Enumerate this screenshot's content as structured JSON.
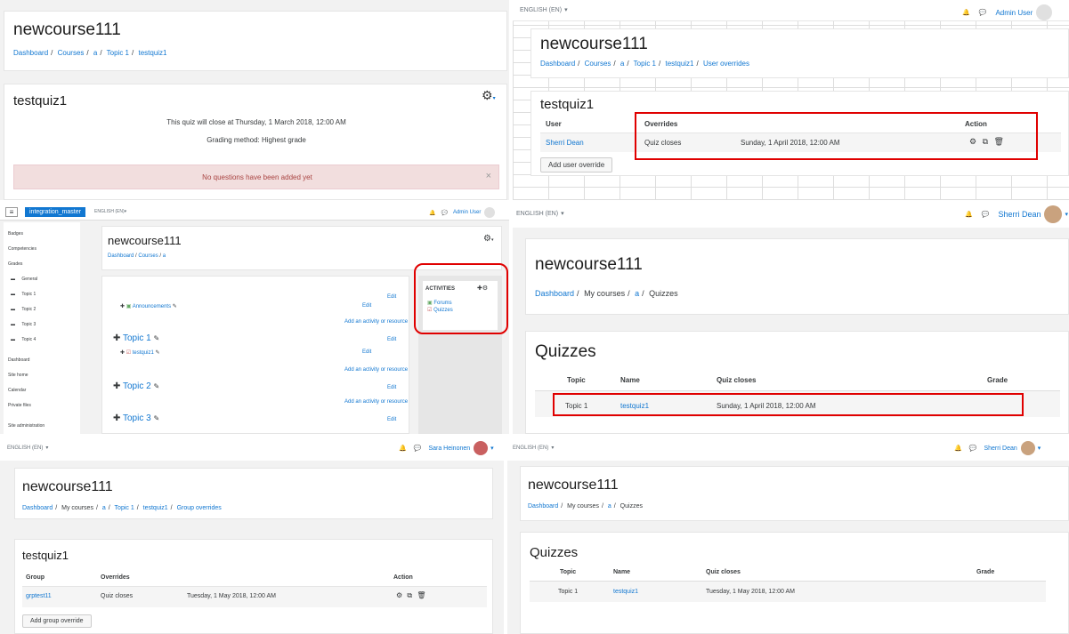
{
  "p1": {
    "title": "newcourse111",
    "breadcrumb": [
      "Dashboard",
      "Courses",
      "a",
      "Topic 1",
      "testquiz1"
    ],
    "quiz_title": "testquiz1",
    "close_text": "This quiz will close at Thursday, 1 March 2018, 12:00 AM",
    "grading": "Grading method: Highest grade",
    "alert": "No questions have been added yet",
    "alert_close": "×"
  },
  "p2": {
    "lang": "ENGLISH (EN)",
    "user": "Admin User",
    "title": "newcourse111",
    "breadcrumb": [
      "Dashboard",
      "Courses",
      "a",
      "Topic 1",
      "testquiz1",
      "User overrides"
    ],
    "quiz_title": "testquiz1",
    "col_user": "User",
    "col_overrides": "Overrides",
    "col_action": "Action",
    "row_user": "Sherri Dean",
    "row_override": "Quiz closes",
    "row_date": "Sunday, 1 April 2018, 12:00 AM",
    "add_button": "Add user override"
  },
  "p3": {
    "site": "integration_master",
    "lang": "ENGLISH (EN)",
    "user": "Admin User",
    "sidebar": [
      "Badges",
      "Competencies",
      "Grades"
    ],
    "sections": [
      "General",
      "Topic 1",
      "Topic 2",
      "Topic 3",
      "Topic 4"
    ],
    "sidebar2": [
      "Dashboard",
      "Site home",
      "Calendar",
      "Private files"
    ],
    "site_admin": "Site administration",
    "title": "newcourse111",
    "breadcrumb": [
      "Dashboard",
      "Courses",
      "a"
    ],
    "announcements": "Announcements",
    "edit": "Edit",
    "add_activity": "Add an activity or resource",
    "topic1": "Topic 1",
    "testquiz": "testquiz1",
    "topic2": "Topic 2",
    "topic3": "Topic 3",
    "activities_title": "ACTIVITIES",
    "forums": "Forums",
    "quizzes": "Quizzes"
  },
  "p4": {
    "lang": "ENGLISH (EN)",
    "user": "Sherri Dean",
    "title": "newcourse111",
    "breadcrumb": [
      "Dashboard",
      "My courses",
      "a",
      "Quizzes"
    ],
    "section_title": "Quizzes",
    "col_topic": "Topic",
    "col_name": "Name",
    "col_closes": "Quiz closes",
    "col_grade": "Grade",
    "row_topic": "Topic 1",
    "row_name": "testquiz1",
    "row_closes": "Sunday, 1 April 2018, 12:00 AM"
  },
  "p5": {
    "lang": "ENGLISH (EN)",
    "user": "Sara Heinonen",
    "title": "newcourse111",
    "breadcrumb": [
      "Dashboard",
      "My courses",
      "a",
      "Topic 1",
      "testquiz1",
      "Group overrides"
    ],
    "quiz_title": "testquiz1",
    "col_group": "Group",
    "col_overrides": "Overrides",
    "col_action": "Action",
    "row_group": "grptest11",
    "row_override": "Quiz closes",
    "row_date": "Tuesday, 1 May 2018, 12:00 AM",
    "add_button": "Add group override"
  },
  "p6": {
    "lang": "ENGLISH (EN)",
    "user": "Sherri Dean",
    "title": "newcourse111",
    "breadcrumb": [
      "Dashboard",
      "My courses",
      "a",
      "Quizzes"
    ],
    "section_title": "Quizzes",
    "col_topic": "Topic",
    "col_name": "Name",
    "col_closes": "Quiz closes",
    "col_grade": "Grade",
    "row_topic": "Topic 1",
    "row_name": "testquiz1",
    "row_closes": "Tuesday, 1 May 2018, 12:00 AM"
  },
  "colors": {
    "link": "#1177d1",
    "highlight": "#e00000",
    "alert_bg": "#f2dede",
    "alert_text": "#a94442",
    "brand": "#1177d1"
  }
}
